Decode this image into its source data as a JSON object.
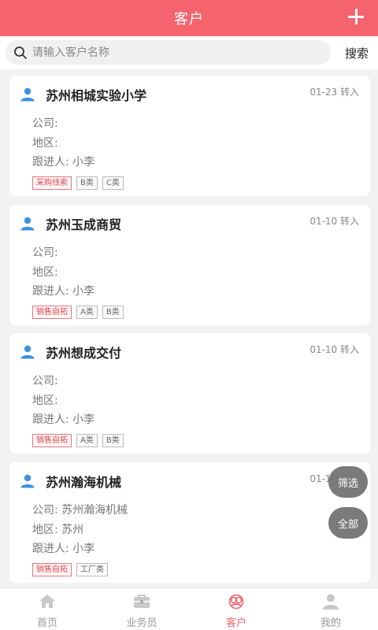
{
  "header": {
    "title": "客户"
  },
  "search": {
    "placeholder": "请输入客户名称",
    "button_label": "搜索"
  },
  "customers": [
    {
      "name": "苏州相城实验小学",
      "date": "01-23 转入",
      "company": "公司:",
      "region": "地区:",
      "follower": "跟进人: 小李",
      "tags": [
        {
          "label": "采购线索",
          "style": "red"
        },
        {
          "label": "B类"
        },
        {
          "label": "C类"
        }
      ]
    },
    {
      "name": "苏州玉成商贸",
      "date": "01-10 转入",
      "company": "公司:",
      "region": "地区:",
      "follower": "跟进人: 小李",
      "tags": [
        {
          "label": "销售自拓",
          "style": "red"
        },
        {
          "label": "A类"
        },
        {
          "label": "B类"
        }
      ]
    },
    {
      "name": "苏州想成交付",
      "date": "01-10 转入",
      "company": "公司:",
      "region": "地区:",
      "follower": "跟进人: 小李",
      "tags": [
        {
          "label": "销售自拓",
          "style": "red"
        },
        {
          "label": "A类"
        },
        {
          "label": "B类"
        }
      ]
    },
    {
      "name": "苏州瀚海机械",
      "date": "01-10 转入",
      "company": "公司: 苏州瀚海机械",
      "region": "地区: 苏州",
      "follower": "跟进人: 小李",
      "tags": [
        {
          "label": "销售自拓",
          "style": "red"
        },
        {
          "label": "工厂类"
        }
      ]
    }
  ],
  "fabs": {
    "filter_label": "筛选",
    "all_label": "全部"
  },
  "tabbar": {
    "items": [
      {
        "label": "首页",
        "icon": "home-icon",
        "active": false
      },
      {
        "label": "业务员",
        "icon": "briefcase-icon",
        "active": false
      },
      {
        "label": "客户",
        "icon": "customer-icon",
        "active": true
      },
      {
        "label": "我的",
        "icon": "profile-icon",
        "active": false
      }
    ]
  },
  "colors": {
    "brand": "#f5646e",
    "person_icon": "#3d8fe0",
    "fab": "#7a7a7a"
  }
}
